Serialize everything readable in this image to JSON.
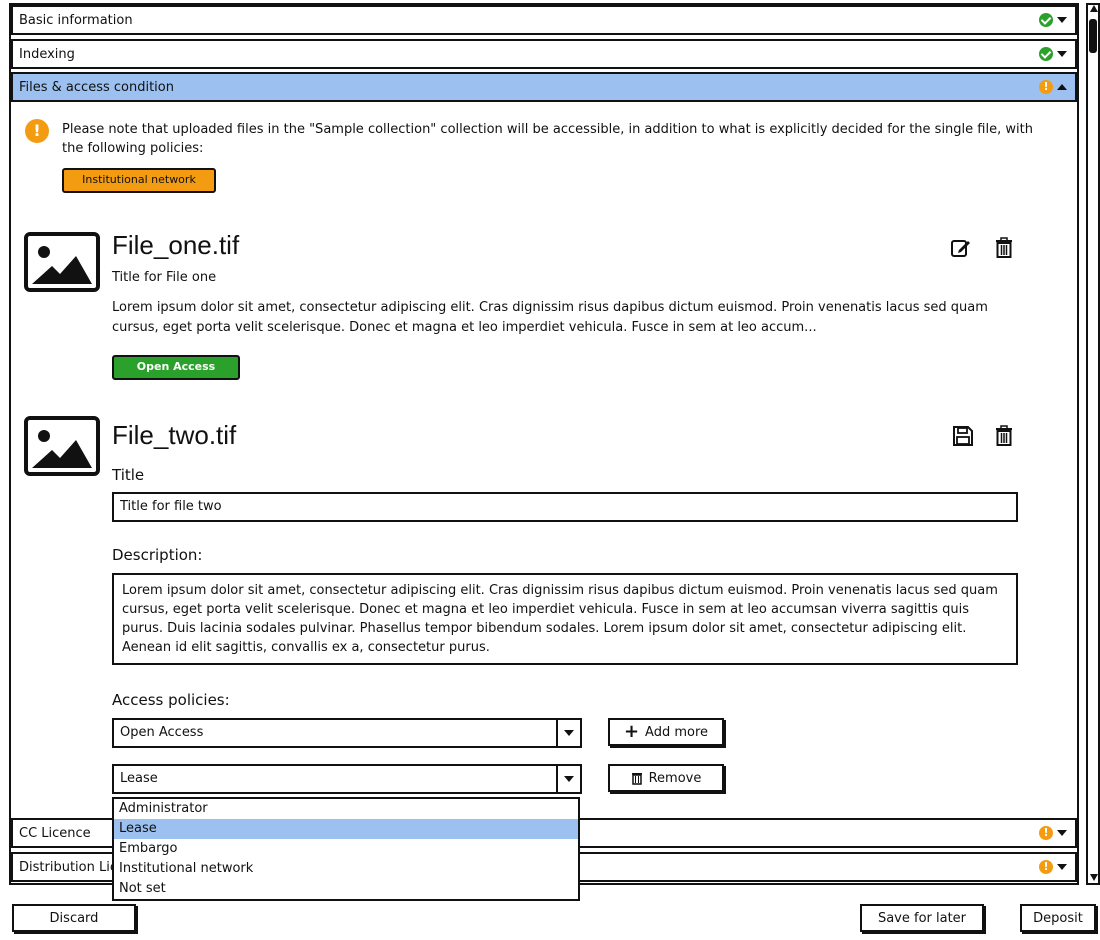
{
  "sections": [
    {
      "title": "Basic information",
      "status": "ok"
    },
    {
      "title": "Indexing",
      "status": "ok"
    },
    {
      "title": "Files & access condition",
      "status": "warn"
    },
    {
      "title": "CC Licence",
      "status": "warn"
    },
    {
      "title": "Distribution Licence",
      "status": "warn"
    }
  ],
  "notice": {
    "text": "Please note that uploaded files in the \"Sample collection\" collection will be accessible, in addition to what is explicitly decided for the single file, with the following policies:",
    "policy": "Institutional network"
  },
  "files": [
    {
      "name": "File_one.tif",
      "title": "Title for File one",
      "description": "Lorem ipsum dolor sit amet, consectetur adipiscing elit. Cras dignissim risus dapibus dictum euismod. Proin venenatis lacus sed quam cursus, eget porta velit scelerisque. Donec et magna et leo imperdiet vehicula. Fusce in sem at leo accum...",
      "access": "Open Access"
    },
    {
      "name": "File_two.tif",
      "title_label": "Title",
      "title_value": "Title for file two",
      "description_label": "Description:",
      "description_value": "Lorem ipsum dolor sit amet, consectetur adipiscing elit. Cras dignissim risus dapibus dictum euismod. Proin venenatis lacus sed quam cursus, eget porta velit scelerisque. Donec et magna et leo imperdiet vehicula. Fusce in sem at leo accumsan viverra sagittis quis purus. Duis lacinia sodales pulvinar. Phasellus tempor bibendum sodales. Lorem ipsum dolor sit amet, consectetur adipiscing elit. Aenean id elit sagittis, convallis ex a, consectetur purus.",
      "policies_label": "Access policies:",
      "policies": [
        "Open Access",
        "Lease"
      ],
      "add_more": "Add more",
      "remove": "Remove"
    }
  ],
  "dropdown_options": [
    "Administrator",
    "Lease",
    "Embargo",
    "Institutional network",
    "Not set"
  ],
  "dropdown_selected": "Lease",
  "footer": {
    "discard": "Discard",
    "save_later": "Save for later",
    "deposit": "Deposit"
  },
  "colors": {
    "selected_bg": "#9cc0f0",
    "warn": "#f39c12",
    "ok": "#2aa12a"
  }
}
